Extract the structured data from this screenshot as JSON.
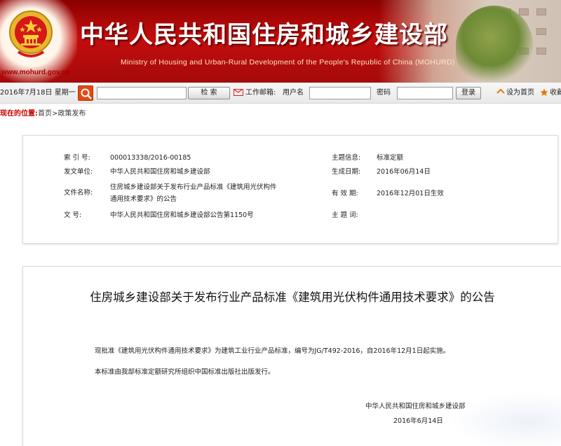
{
  "header": {
    "title": "中华人民共和国住房和城乡建设部",
    "subtitle": "Ministry of Housing and Urban-Rural Development of the People's Republic of China (MOHURD)",
    "url": "www.mohurd.gov.cn"
  },
  "toolbar": {
    "date": "2016年7月18日 星期一",
    "search_button": "检  索",
    "mail_label": "工作邮箱:",
    "username_label": "用户名",
    "password_label": "密码",
    "login_button": "登录",
    "set_home": "设为首页",
    "favorite": "收藏"
  },
  "location": {
    "label": "现在的位置:",
    "path": "首页>政策发布"
  },
  "info": {
    "index_label": "索 引 号:",
    "index_value": "000013338/2016-00185",
    "issuer_label": "发文单位:",
    "issuer_value": "中华人民共和国住房和城乡建设部",
    "filename_label": "文件名称:",
    "filename_line1": "住房城乡建设部关于发布行业产品标准《建筑用光伏构件",
    "filename_line2": "通用技术要求》的公告",
    "docno_label": "文      号:",
    "docno_value": "中华人民共和国住房和城乡建设部公告第1150号",
    "topic_label": "主题信息:",
    "topic_value": "标准定额",
    "created_label": "生成日期:",
    "created_value": "2016年06月14日",
    "valid_label": "有 效 期:",
    "valid_value": "2016年12月01日生效",
    "keywords_label": "主 题 词:"
  },
  "article": {
    "title": "住房城乡建设部关于发布行业产品标准《建筑用光伏构件通用技术要求》的公告",
    "para1": "现批准《建筑用光伏构件通用技术要求》为建筑工业行业产品标准，编号为JG/T492-2016，自2016年12月1日起实施。",
    "para2": "本标准由我部标准定额研究所组织中国标准出版社出版发行。",
    "signature": "中华人民共和国住房和城乡建设部",
    "date": "2016年6月14日"
  },
  "colors": {
    "banner_red": "#c40d0d",
    "accent_red": "#cc0000",
    "search_orange": "#e14a14"
  }
}
